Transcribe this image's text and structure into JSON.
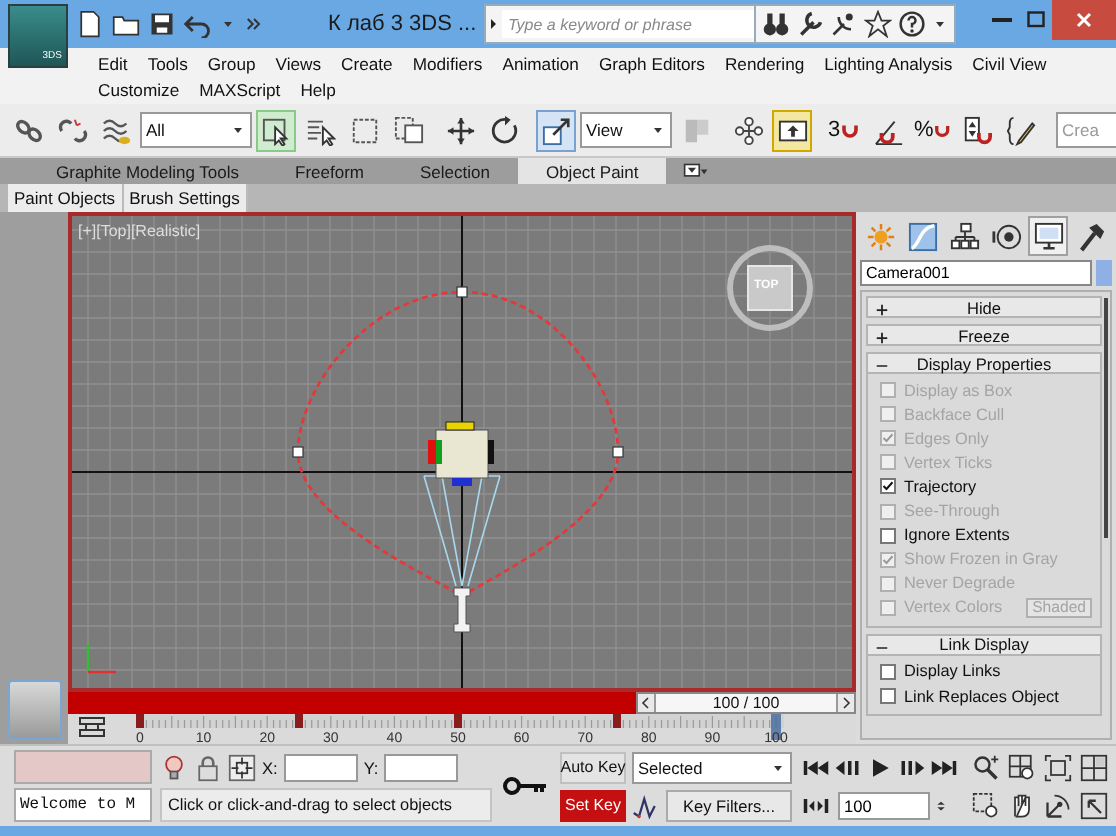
{
  "app_button": {
    "label": "3DS"
  },
  "title_bar": {
    "title": "К лаб 3 3DS ...",
    "search": {
      "placeholder": "Type a keyword or phrase"
    }
  },
  "menu": [
    [
      "Edit",
      "Tools",
      "Group",
      "Views",
      "Create",
      "Modifiers",
      "Animation",
      "Graph Editors",
      "Rendering",
      "Lighting Analysis",
      "Civil View"
    ],
    [
      "Customize",
      "MAXScript",
      "Help"
    ]
  ],
  "toolbar": [
    {
      "kind": "link",
      "on": false
    },
    {
      "kind": "unlink",
      "on": false
    },
    {
      "kind": "bind",
      "on": false
    },
    {
      "kind": "dropdown",
      "value": "All"
    },
    {
      "kind": "select",
      "on": true
    },
    {
      "kind": "selectname",
      "on": false
    },
    {
      "kind": "region",
      "on": false
    },
    {
      "kind": "crossing",
      "on": false
    },
    {
      "kind": "move",
      "on": false
    },
    {
      "kind": "rotate",
      "on": false
    },
    {
      "kind": "scale",
      "on": true
    },
    {
      "kind": "dropdown",
      "value": "View"
    },
    {
      "kind": "pivot",
      "on": false
    },
    {
      "kind": "manipulate",
      "on": false
    },
    {
      "kind": "override",
      "on": true
    },
    {
      "kind": "snap",
      "label": "3",
      "on": false
    },
    {
      "kind": "anglesnap",
      "on": false
    },
    {
      "kind": "percentsnap",
      "label": "%",
      "on": false
    },
    {
      "kind": "spinnersnap",
      "on": false
    },
    {
      "kind": "editsel",
      "on": false
    },
    {
      "kind": "field",
      "placeholder": "Crea"
    }
  ],
  "ribbon": {
    "tabs": [
      {
        "label": "Graphite Modeling Tools",
        "selected": false
      },
      {
        "label": "Freeform",
        "selected": false
      },
      {
        "label": "Selection",
        "selected": false
      },
      {
        "label": "Object Paint",
        "selected": true
      }
    ],
    "panels": [
      "Paint Objects",
      "Brush Settings"
    ]
  },
  "viewport": {
    "label": "[+][Top][Realistic]",
    "viewcube": "TOP"
  },
  "time_slider": {
    "label": "100 / 100"
  },
  "track_bar": {
    "labels": [
      "0",
      "10",
      "20",
      "30",
      "40",
      "50",
      "60",
      "70",
      "80",
      "90",
      "100"
    ]
  },
  "command_panel": {
    "tabs": [
      {
        "kind": "create",
        "selected": false
      },
      {
        "kind": "modify",
        "selected": false
      },
      {
        "kind": "hierarchy",
        "selected": false
      },
      {
        "kind": "motion",
        "selected": false
      },
      {
        "kind": "display",
        "selected": true
      },
      {
        "kind": "utilities",
        "selected": false
      }
    ],
    "object_name": "Camera001",
    "rollouts": [
      {
        "title": "Hide",
        "expanded": false
      },
      {
        "title": "Freeze",
        "expanded": false
      },
      {
        "title": "Display Properties",
        "expanded": true,
        "items": [
          {
            "label": "Display as Box",
            "checked": false,
            "disabled": true
          },
          {
            "label": "Backface Cull",
            "checked": false,
            "disabled": true
          },
          {
            "label": "Edges Only",
            "checked": true,
            "disabled": true
          },
          {
            "label": "Vertex Ticks",
            "checked": false,
            "disabled": true
          },
          {
            "label": "Trajectory",
            "checked": true,
            "disabled": false
          },
          {
            "label": "See-Through",
            "checked": false,
            "disabled": true
          },
          {
            "label": "Ignore Extents",
            "checked": false,
            "disabled": false
          },
          {
            "label": "Show Frozen in Gray",
            "checked": true,
            "disabled": true
          },
          {
            "label": "Never Degrade",
            "checked": false,
            "disabled": true
          },
          {
            "label": "Vertex Colors",
            "checked": false,
            "disabled": true,
            "button": "Shaded"
          }
        ]
      },
      {
        "title": "Link Display",
        "expanded": true,
        "items": [
          {
            "label": "Display Links",
            "checked": false,
            "disabled": false
          },
          {
            "label": "Link Replaces Object",
            "checked": false,
            "disabled": false
          }
        ]
      }
    ]
  },
  "status_bar": {
    "listener_output": "Welcome to M",
    "x_label": "X:",
    "y_label": "Y:",
    "prompt": "Click or click-and-drag to select objects",
    "auto_key": "Auto Key",
    "key_mode": "Selected",
    "set_key": "Set Key",
    "key_filters": "Key Filters...",
    "frame": "100"
  }
}
